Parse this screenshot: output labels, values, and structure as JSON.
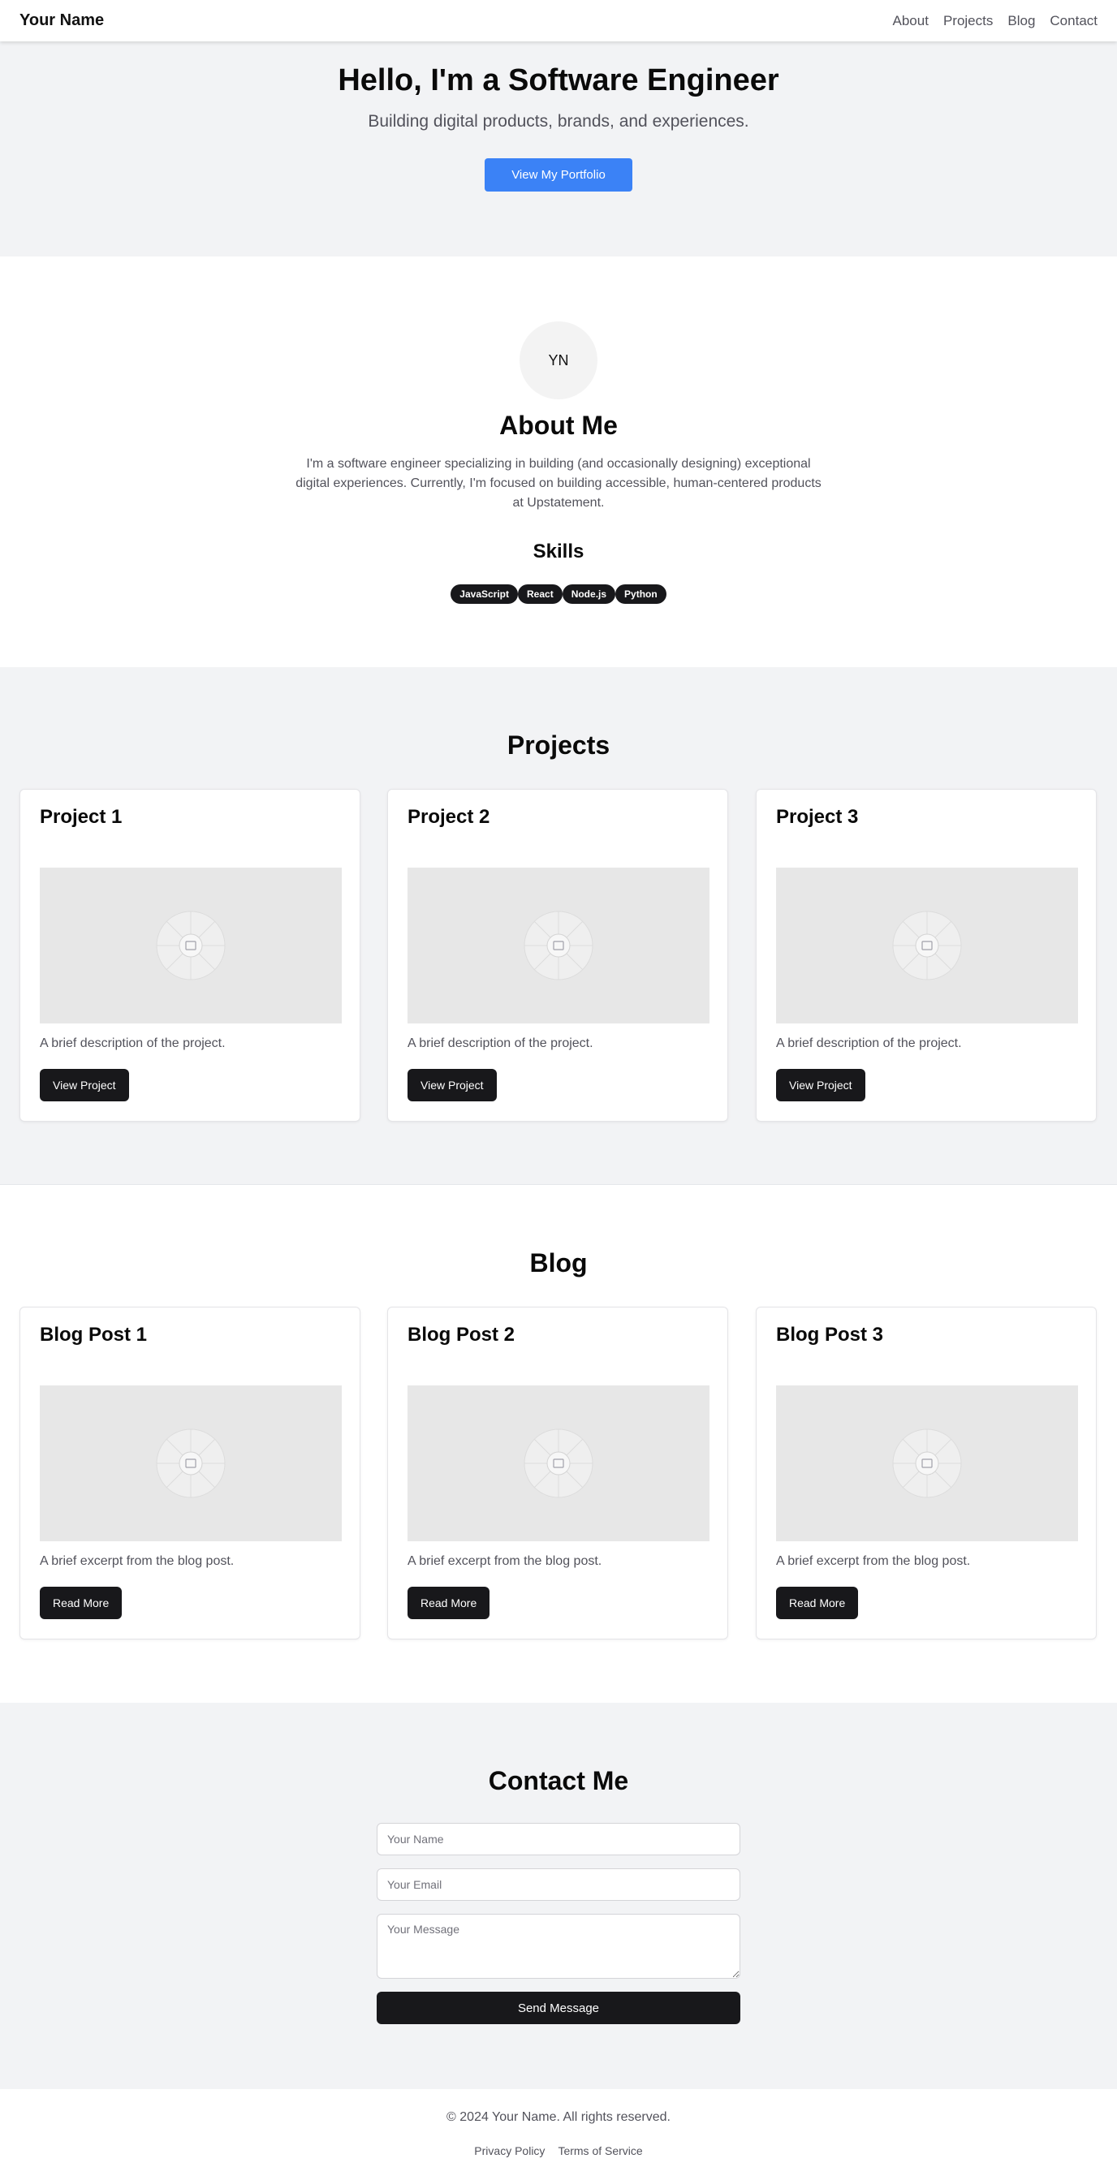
{
  "header": {
    "brand": "Your Name",
    "nav": [
      "About",
      "Projects",
      "Blog",
      "Contact"
    ]
  },
  "hero": {
    "title": "Hello, I'm a Software Engineer",
    "subtitle": "Building digital products, brands, and experiences.",
    "cta": "View My Portfolio"
  },
  "about": {
    "initials": "YN",
    "title": "About Me",
    "bio": "I'm a software engineer specializing in building (and occasionally designing) exceptional digital experiences. Currently, I'm focused on building accessible, human-centered products at Upstatement.",
    "skills_title": "Skills",
    "skills": [
      "JavaScript",
      "React",
      "Node.js",
      "Python"
    ]
  },
  "projects": {
    "title": "Projects",
    "items": [
      {
        "title": "Project 1",
        "desc": "A brief description of the project.",
        "button": "View Project"
      },
      {
        "title": "Project 2",
        "desc": "A brief description of the project.",
        "button": "View Project"
      },
      {
        "title": "Project 3",
        "desc": "A brief description of the project.",
        "button": "View Project"
      }
    ]
  },
  "blog": {
    "title": "Blog",
    "items": [
      {
        "title": "Blog Post 1",
        "desc": "A brief excerpt from the blog post.",
        "button": "Read More"
      },
      {
        "title": "Blog Post 2",
        "desc": "A brief excerpt from the blog post.",
        "button": "Read More"
      },
      {
        "title": "Blog Post 3",
        "desc": "A brief excerpt from the blog post.",
        "button": "Read More"
      }
    ]
  },
  "contact": {
    "title": "Contact Me",
    "name_placeholder": "Your Name",
    "email_placeholder": "Your Email",
    "message_placeholder": "Your Message",
    "send": "Send Message"
  },
  "footer": {
    "copyright": "© 2024 Your Name. All rights reserved.",
    "links": [
      "Privacy Policy",
      "Terms of Service"
    ]
  },
  "colors": {
    "accent": "#3b82f6",
    "dark": "#18181b",
    "muted_bg": "#f2f3f5"
  },
  "icons": {
    "image_placeholder": "image-placeholder-icon"
  }
}
